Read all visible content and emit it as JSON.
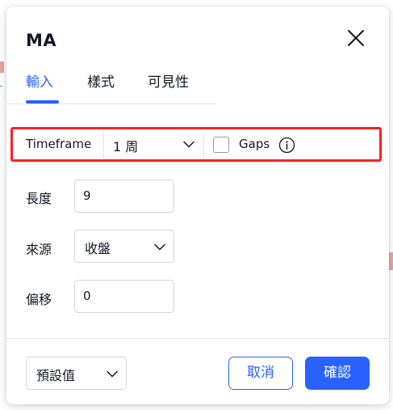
{
  "dialog": {
    "title": "MA"
  },
  "tabs": [
    {
      "label": "輸入",
      "active": true
    },
    {
      "label": "樣式",
      "active": false
    },
    {
      "label": "可見性",
      "active": false
    }
  ],
  "timeframe": {
    "label": "Timeframe",
    "value": "1 周",
    "gaps_label": "Gaps",
    "gaps_checked": false
  },
  "fields": {
    "length": {
      "label": "長度",
      "value": "9"
    },
    "source": {
      "label": "來源",
      "value": "收盤"
    },
    "offset": {
      "label": "偏移",
      "value": "0"
    }
  },
  "footer": {
    "preset_label": "預設值",
    "cancel_label": "取消",
    "ok_label": "確認"
  },
  "colors": {
    "accent": "#2962ff",
    "highlight": "#ff1f1f",
    "text": "#131722"
  },
  "icons": {
    "close": "close-icon",
    "chevron": "chevron-down-icon",
    "info": "info-icon"
  }
}
